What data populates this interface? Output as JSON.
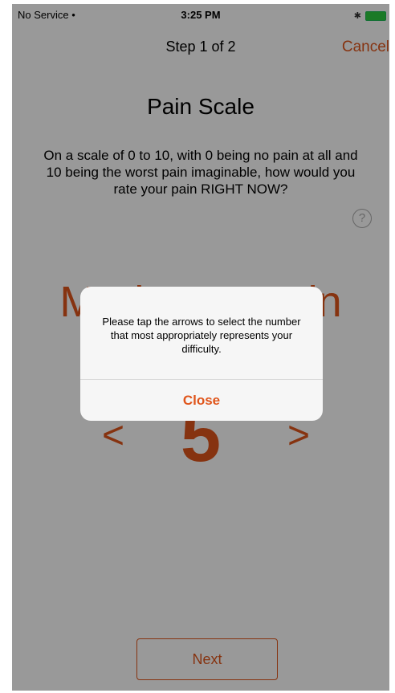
{
  "status_bar": {
    "carrier": "No Service",
    "time": "3:25 PM"
  },
  "nav": {
    "step": "Step 1 of 2",
    "cancel_label": "Cancel"
  },
  "content": {
    "title": "Pain Scale",
    "question": "On a scale of 0 to 10, with 0 being no pain at all and 10 being the worst pain imaginable, how would you rate your pain RIGHT NOW?",
    "help_glyph": "?",
    "scale_label": "Moderate Pain",
    "scale_value": "5",
    "left_arrow": "<",
    "right_arrow": ">",
    "next_label": "Next"
  },
  "alert": {
    "message": "Please tap the arrows to select the number that most appropriately represents your difficulty.",
    "close_label": "Close"
  },
  "colors": {
    "accent": "#e0551b",
    "overlay": "rgba(0,0,0,0.4)",
    "battery": "#2ecc40"
  }
}
